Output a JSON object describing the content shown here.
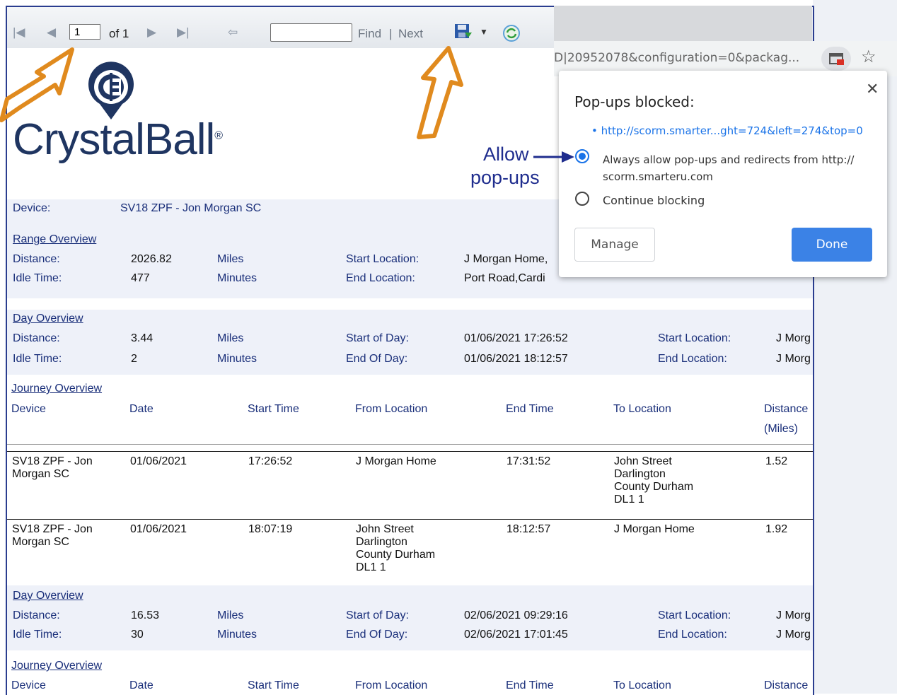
{
  "toolbar": {
    "page_value": "1",
    "of_label": "of 1",
    "find_label": "Find",
    "separator": "|",
    "next_label": "Next",
    "icons": [
      "first-page-icon",
      "prev-page-icon",
      "next-page-icon",
      "last-page-icon",
      "back-icon",
      "save-icon",
      "dropdown-icon",
      "refresh-icon"
    ]
  },
  "logo": {
    "text": "CrystalBall",
    "reg": "®"
  },
  "annotation": {
    "line1": "Allow",
    "line2": "pop-ups"
  },
  "device": {
    "label": "Device:",
    "value": "SV18 ZPF - Jon Morgan SC"
  },
  "range": {
    "title": "Range Overview",
    "distance_label": "Distance:",
    "distance": "2026.82",
    "distance_unit": "Miles",
    "idle_label": "Idle Time:",
    "idle": "477",
    "idle_unit": "Minutes",
    "start_loc_label": "Start Location:",
    "start_loc": "J Morgan Home,",
    "end_loc_label": "End Location:",
    "end_loc": "Port Road,Cardi"
  },
  "days": [
    {
      "title": "Day Overview",
      "distance_label": "Distance:",
      "distance": "3.44",
      "distance_unit": "Miles",
      "idle_label": "Idle Time:",
      "idle": "2",
      "idle_unit": "Minutes",
      "start_day_label": "Start of Day:",
      "start_day": "01/06/2021 17:26:52",
      "end_day_label": "End Of Day:",
      "end_day": "01/06/2021 18:12:57",
      "start_loc_label": "Start Location:",
      "start_loc": "J Morg",
      "end_loc_label": "End Location:",
      "end_loc": "J Morg"
    },
    {
      "title": "Day Overview",
      "distance_label": "Distance:",
      "distance": "16.53",
      "distance_unit": "Miles",
      "idle_label": "Idle Time:",
      "idle": "30",
      "idle_unit": "Minutes",
      "start_day_label": "Start of Day:",
      "start_day": "02/06/2021 09:29:16",
      "end_day_label": "End Of Day:",
      "end_day": "02/06/2021 17:01:45",
      "start_loc_label": "Start Location:",
      "start_loc": "J Morg",
      "end_loc_label": "End Location:",
      "end_loc": "J Morg"
    }
  ],
  "journey": {
    "title": "Journey Overview",
    "columns": [
      "Device",
      "Date",
      "Start Time",
      "From Location",
      "End Time",
      "To Location",
      "Distance",
      "(Miles)"
    ],
    "rows": [
      {
        "device": "SV18 ZPF - Jon\nMorgan SC",
        "date": "01/06/2021",
        "start": "17:26:52",
        "from": "J Morgan Home",
        "end": "17:31:52",
        "to": "John Street\nDarlington\nCounty Durham\nDL1 1",
        "distance": "1.52"
      },
      {
        "device": "SV18 ZPF - Jon\nMorgan SC",
        "date": "01/06/2021",
        "start": "18:07:19",
        "from": "John Street\nDarlington\nCounty Durham\nDL1 1",
        "end": "18:12:57",
        "to": "J Morgan Home",
        "distance": "1.92"
      }
    ]
  },
  "browser": {
    "url": "D|20952078&configuration=0&packag...",
    "popup": {
      "title": "Pop-ups blocked:",
      "link": "http://scorm.smarter...ght=724&left=274&top=0",
      "option_allow": "Always allow pop-ups and redirects from http://\nscorm.smarteru.com",
      "option_block": "Continue blocking",
      "manage": "Manage",
      "done": "Done"
    }
  },
  "colors": {
    "label_blue": "#1a2f7a",
    "band": "#eef1f9",
    "done_blue": "#3b82e6",
    "arrow_orange": "#e08a1e"
  }
}
